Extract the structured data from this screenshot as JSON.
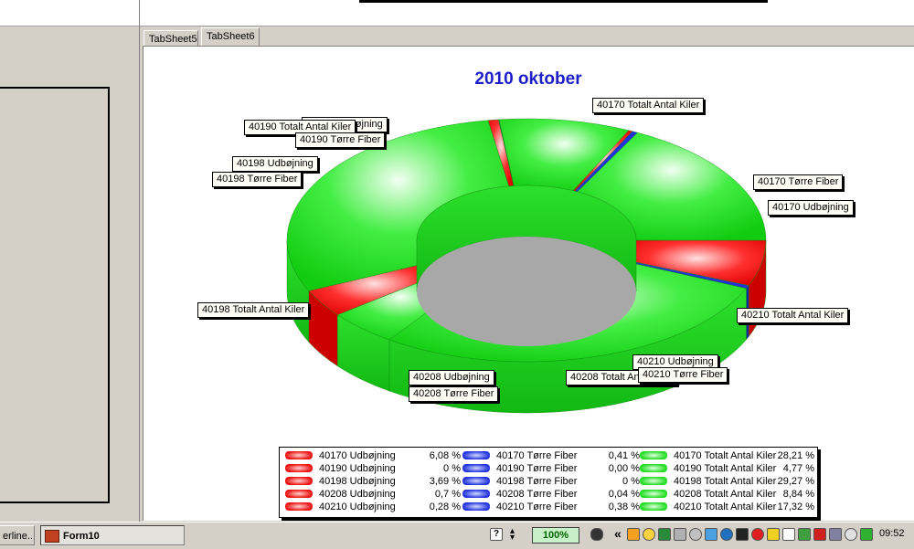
{
  "window": {
    "tabs": [
      {
        "label": "TabSheet5",
        "active": false
      },
      {
        "label": "TabSheet6",
        "active": true
      }
    ]
  },
  "colors": {
    "udbojning": "#ee1111",
    "torre_fiber": "#2233dd",
    "antal_kiler": "#22dd22",
    "title": "#1e1ec8"
  },
  "chart_data": {
    "type": "pie",
    "style": "3d-donut",
    "title": "2010 oktober",
    "legend_position": "bottom",
    "slices": [
      {
        "label": "40170 Udbøjning",
        "value": 6.08,
        "value_text": "6,08 %",
        "group": "udbojning"
      },
      {
        "label": "40170 Tørre Fiber",
        "value": 0.41,
        "value_text": "0,41 %",
        "group": "torre_fiber"
      },
      {
        "label": "40170 Totalt Antal Kiler",
        "value": 28.21,
        "value_text": "28,21 %",
        "group": "antal_kiler"
      },
      {
        "label": "40190 Udbøjning",
        "value": 0,
        "value_text": "0 %",
        "group": "udbojning"
      },
      {
        "label": "40190 Tørre Fiber",
        "value": 0.0,
        "value_text": "0,00 %",
        "group": "torre_fiber"
      },
      {
        "label": "40190 Totalt Antal Kiler",
        "value": 4.77,
        "value_text": "4,77 %",
        "group": "antal_kiler"
      },
      {
        "label": "40198 Udbøjning",
        "value": 3.69,
        "value_text": "3,69 %",
        "group": "udbojning"
      },
      {
        "label": "40198 Tørre Fiber",
        "value": 0,
        "value_text": "0 %",
        "group": "torre_fiber"
      },
      {
        "label": "40198 Totalt Antal Kiler",
        "value": 29.27,
        "value_text": "29,27 %",
        "group": "antal_kiler"
      },
      {
        "label": "40208 Udbøjning",
        "value": 0.7,
        "value_text": "0,7 %",
        "group": "udbojning"
      },
      {
        "label": "40208 Tørre Fiber",
        "value": 0.04,
        "value_text": "0,04 %",
        "group": "torre_fiber"
      },
      {
        "label": "40208 Totalt Antal Kiler",
        "value": 8.84,
        "value_text": "8,84 %",
        "group": "antal_kiler"
      },
      {
        "label": "40210 Udbøjning",
        "value": 0.28,
        "value_text": "0,28 %",
        "group": "udbojning"
      },
      {
        "label": "40210 Tørre Fiber",
        "value": 0.38,
        "value_text": "0,38 %",
        "group": "torre_fiber"
      },
      {
        "label": "40210 Totalt Antal Kiler",
        "value": 17.32,
        "value_text": "17,32 %",
        "group": "antal_kiler"
      }
    ],
    "callout_labels": [
      "40170 Totalt Antal Kiler",
      "40190 Udbøjning",
      "40190 Totalt Antal Kiler",
      "40190 Tørre Fiber",
      "40198 Udbøjning",
      "40198 Tørre Fiber",
      "40170 Tørre Fiber",
      "40170 Udbøjning",
      "40198 Totalt Antal Kiler",
      "40210 Totalt Antal Kiler",
      "40210 Udbøjning",
      "40208 Udbøjning",
      "40208 Totalt Antal Kiler",
      "40210 Tørre Fiber",
      "40208 Tørre Fiber"
    ]
  },
  "taskbar": {
    "left_button": "erline...",
    "form_button": "Form10",
    "zoom": "100%",
    "chevron": "«",
    "clock": "09:52"
  }
}
